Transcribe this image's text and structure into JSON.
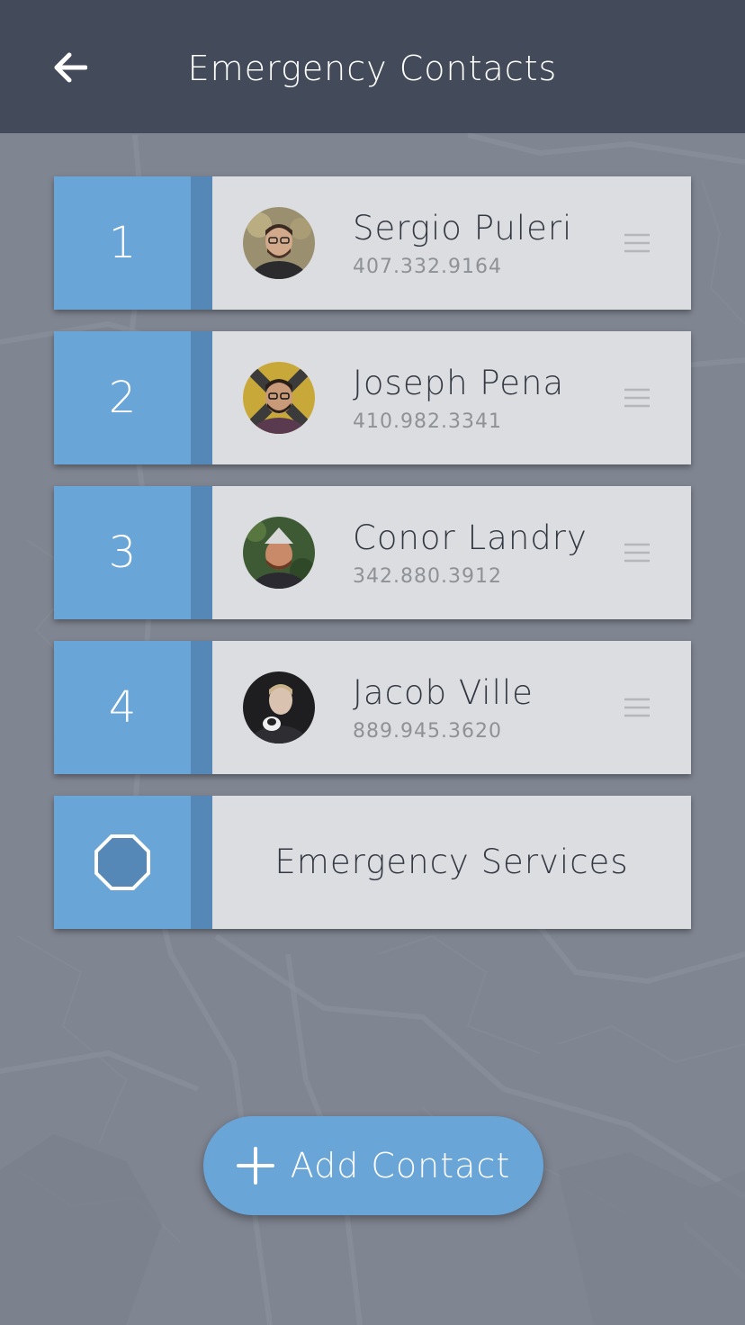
{
  "header": {
    "title": "Emergency Contacts",
    "back_icon": "arrow-left-icon"
  },
  "contacts": [
    {
      "rank": "1",
      "name": "Sergio Puleri",
      "phone": "407.332.9164"
    },
    {
      "rank": "2",
      "name": "Joseph Pena",
      "phone": "410.982.3341"
    },
    {
      "rank": "3",
      "name": "Conor Landry",
      "phone": "342.880.3912"
    },
    {
      "rank": "4",
      "name": "Jacob Ville",
      "phone": "889.945.3620"
    }
  ],
  "services": {
    "label": "Emergency Services",
    "icon": "octagon-icon"
  },
  "add_button": {
    "label": "Add Contact",
    "icon": "plus-icon"
  },
  "colors": {
    "header": "#434a5a",
    "background": "#7f8591",
    "accent": "#6aa5d8",
    "accent_dark": "#5588b6",
    "card": "#dcdde0"
  }
}
